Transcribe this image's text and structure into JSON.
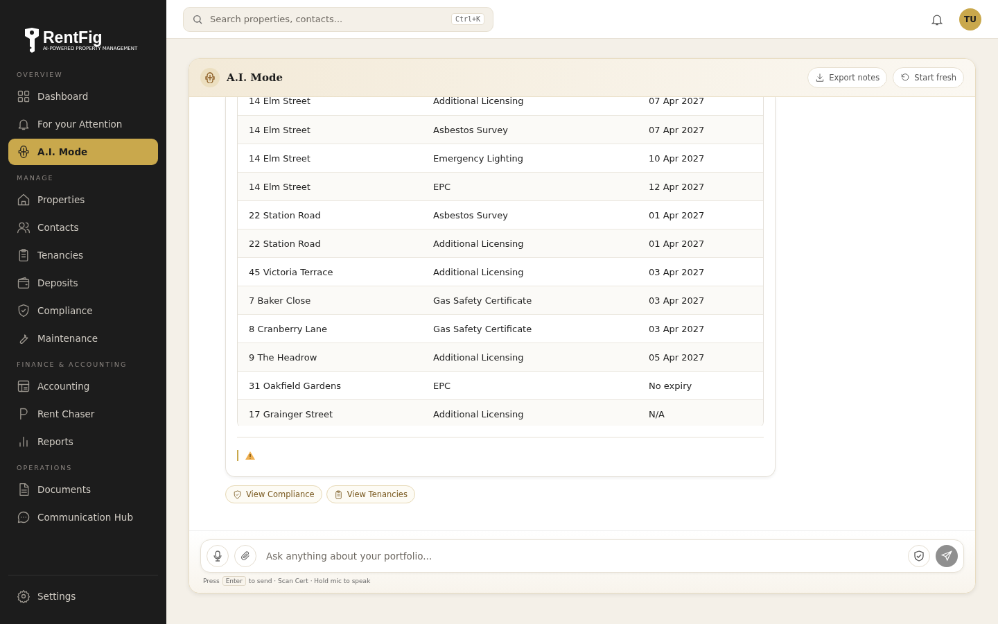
{
  "brand": {
    "name": "RentFig",
    "tagline": "AI-POWERED PROPERTY MANAGEMENT"
  },
  "sidebar": {
    "sections": [
      {
        "heading": "OVERVIEW",
        "items": [
          {
            "label": "Dashboard",
            "selected": false
          },
          {
            "label": "For your Attention",
            "selected": false
          },
          {
            "label": "A.I. Mode",
            "selected": true
          }
        ]
      },
      {
        "heading": "MANAGE",
        "items": [
          {
            "label": "Properties",
            "selected": false
          },
          {
            "label": "Contacts",
            "selected": false
          },
          {
            "label": "Tenancies",
            "selected": false
          },
          {
            "label": "Deposits",
            "selected": false
          },
          {
            "label": "Compliance",
            "selected": false
          },
          {
            "label": "Maintenance",
            "selected": false
          }
        ]
      },
      {
        "heading": "FINANCE & ACCOUNTING",
        "items": [
          {
            "label": "Accounting",
            "selected": false
          },
          {
            "label": "Rent Chaser",
            "selected": false
          },
          {
            "label": "Reports",
            "selected": false
          }
        ]
      },
      {
        "heading": "OPERATIONS",
        "items": [
          {
            "label": "Documents",
            "selected": false
          },
          {
            "label": "Communication Hub",
            "selected": false
          }
        ]
      }
    ],
    "footer": {
      "label": "Settings",
      "selected": false
    }
  },
  "search": {
    "placeholder": "Search properties, contacts...",
    "shortcut": "Ctrl+K"
  },
  "user": {
    "initials": "TU"
  },
  "panel": {
    "title": "A.I. Mode",
    "actions": [
      {
        "label": "Export notes"
      },
      {
        "label": "Start fresh"
      }
    ]
  },
  "table": {
    "rows": [
      [
        "14 Elm Street",
        "Additional Licensing",
        "07 Apr 2027"
      ],
      [
        "14 Elm Street",
        "Asbestos Survey",
        "07 Apr 2027"
      ],
      [
        "14 Elm Street",
        "Emergency Lighting",
        "10 Apr 2027"
      ],
      [
        "14 Elm Street",
        "EPC",
        "12 Apr 2027"
      ],
      [
        "22 Station Road",
        "Asbestos Survey",
        "01 Apr 2027"
      ],
      [
        "22 Station Road",
        "Additional Licensing",
        "01 Apr 2027"
      ],
      [
        "45 Victoria Terrace",
        "Additional Licensing",
        "03 Apr 2027"
      ],
      [
        "7 Baker Close",
        "Gas Safety Certificate",
        "03 Apr 2027"
      ],
      [
        "8 Cranberry Lane",
        "Gas Safety Certificate",
        "03 Apr 2027"
      ],
      [
        "9 The Headrow",
        "Additional Licensing",
        "05 Apr 2027"
      ],
      [
        "31 Oakfield Gardens",
        "EPC",
        "No expiry"
      ],
      [
        "17 Grainger Street",
        "Additional Licensing",
        "N/A"
      ]
    ]
  },
  "suggestions": [
    {
      "label": "View Compliance"
    },
    {
      "label": "View Tenancies"
    }
  ],
  "composer": {
    "placeholder": "Ask anything about your portfolio...",
    "hint": {
      "before": "Press",
      "key": "Enter",
      "after": "to send · Scan Cert · Hold mic to speak"
    }
  }
}
